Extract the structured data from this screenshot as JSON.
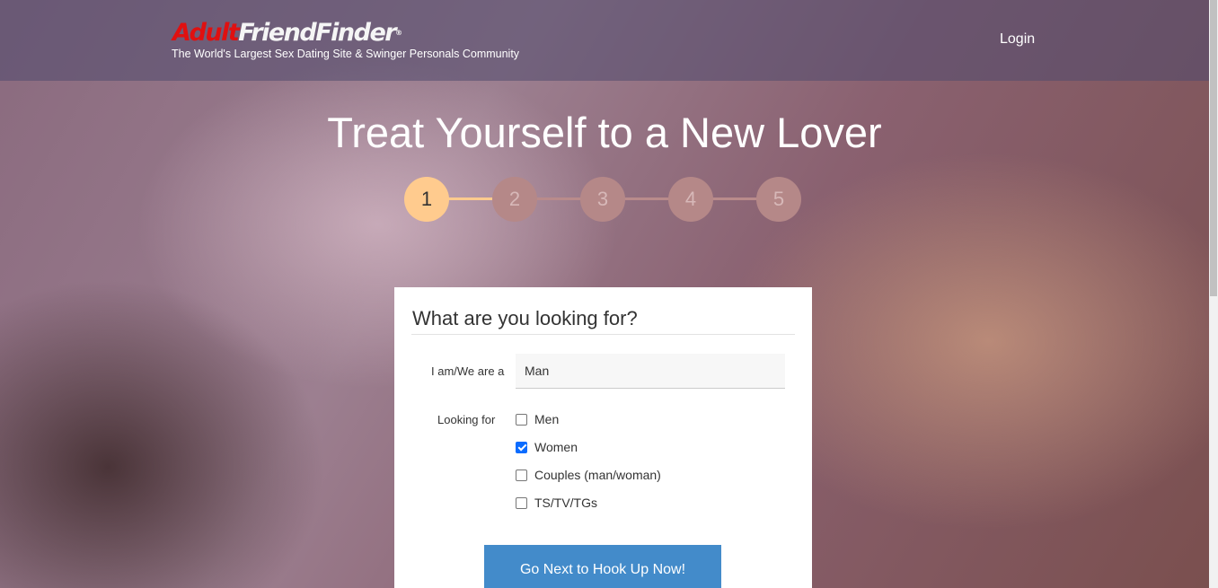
{
  "header": {
    "logo_part1": "Adult",
    "logo_part2": "FriendFinder",
    "logo_mark": "®",
    "tagline": "The World's Largest Sex Dating Site & Swinger Personals Community",
    "login": "Login"
  },
  "hero": {
    "title": "Treat Yourself to a New Lover"
  },
  "steps": {
    "items": [
      "1",
      "2",
      "3",
      "4",
      "5"
    ],
    "current": 1,
    "colors": {
      "active": "#ffcb8e",
      "inactive": "#b58888"
    }
  },
  "form": {
    "heading": "What are you looking for?",
    "iam_label": "I am/We are a",
    "iam_value": "Man",
    "looking_label": "Looking for",
    "options": [
      {
        "label": "Men",
        "checked": false
      },
      {
        "label": "Women",
        "checked": true
      },
      {
        "label": "Couples (man/woman)",
        "checked": false
      },
      {
        "label": "TS/TV/TGs",
        "checked": false
      }
    ],
    "submit": "Go Next to Hook Up Now!"
  },
  "colors": {
    "button": "#438bca",
    "logo_red": "#e01010"
  }
}
